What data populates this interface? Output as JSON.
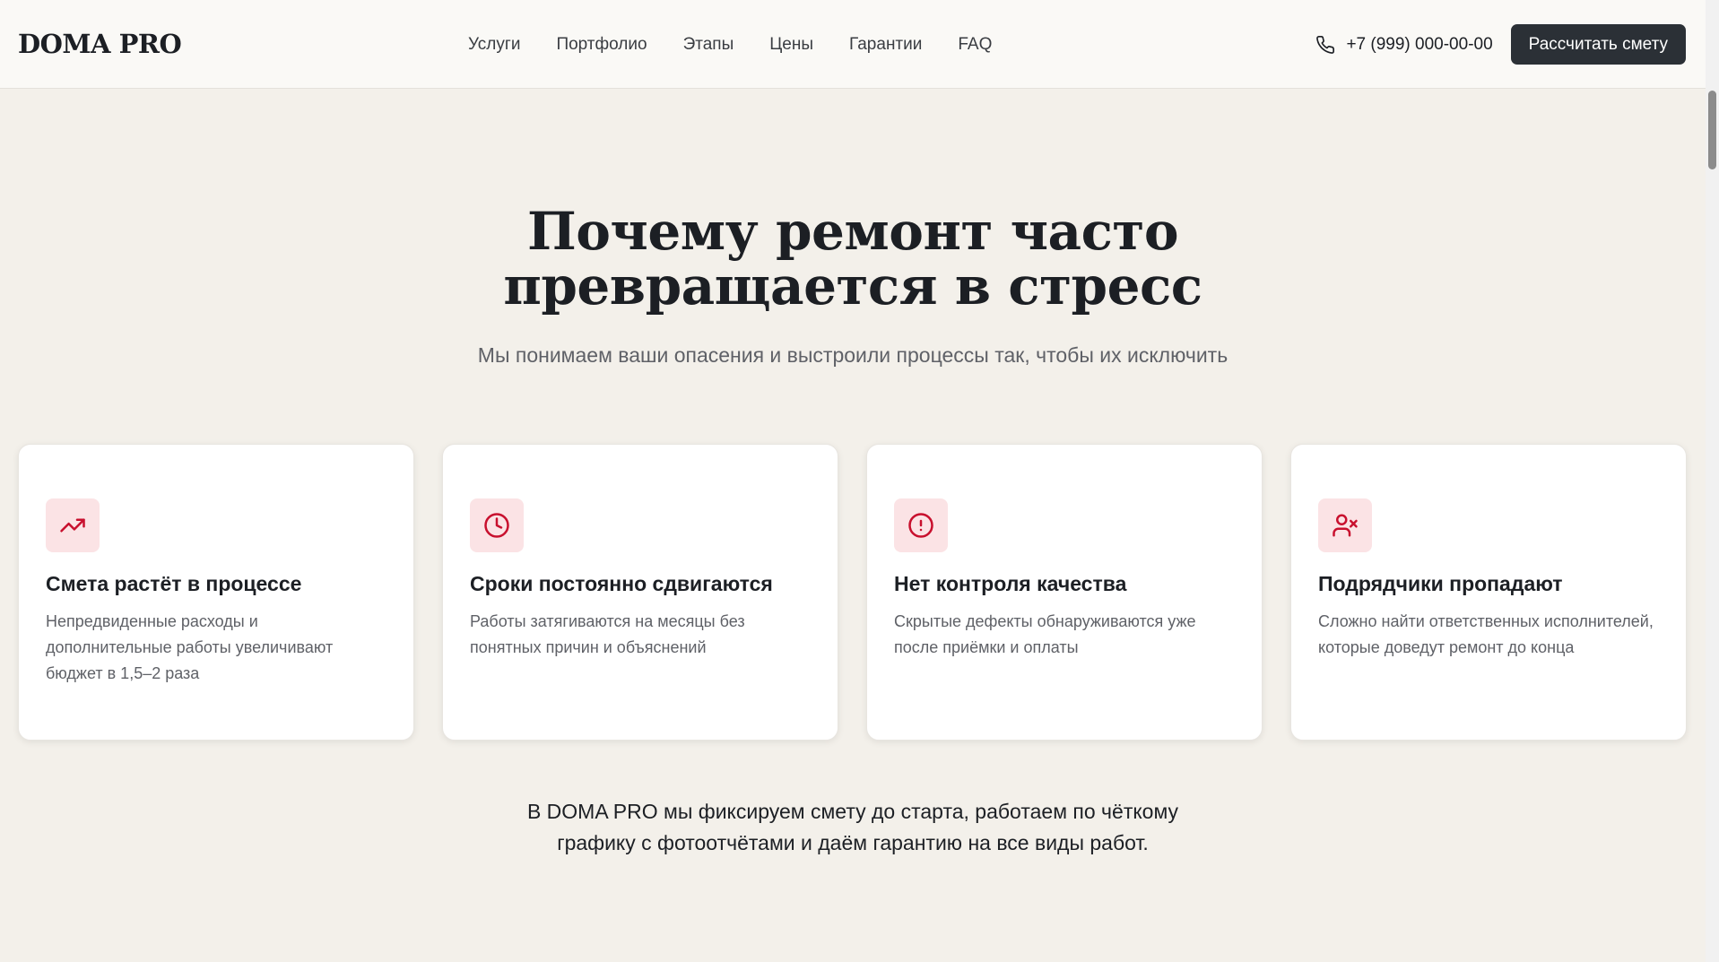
{
  "header": {
    "logo": "DOMA PRO",
    "nav": [
      "Услуги",
      "Портфолио",
      "Этапы",
      "Цены",
      "Гарантии",
      "FAQ"
    ],
    "phone": "+7 (999) 000-00-00",
    "cta_label": "Рассчитать смету"
  },
  "hero": {
    "title_line1": "Почему ремонт часто",
    "title_line2": "превращается в стресс",
    "subtitle": "Мы понимаем ваши опасения и выстроили процессы так, чтобы их исключить"
  },
  "cards": [
    {
      "icon": "trending-up-icon",
      "title": "Смета растёт в процессе",
      "text": "Непредвиденные расходы и дополнительные работы увеличивают бюджет в 1,5–2 раза"
    },
    {
      "icon": "clock-icon",
      "title": "Сроки постоянно сдвигаются",
      "text": "Работы затягиваются на месяцы без понятных причин и объяснений"
    },
    {
      "icon": "alert-circle-icon",
      "title": "Нет контроля качества",
      "text": "Скрытые дефекты обнаруживаются уже после приёмки и оплаты"
    },
    {
      "icon": "user-x-icon",
      "title": "Подрядчики пропадают",
      "text": "Сложно найти ответственных исполнителей, которые доведут ремонт до конца"
    }
  ],
  "footer": {
    "line1": "В DOMA PRO мы фиксируем смету до старта, работаем по чёткому",
    "line2": "графику с фотоотчётами и даём гарантию на все виды работ."
  },
  "colors": {
    "accent": "#c8102e",
    "icon_bg": "#fbe3e5",
    "button_bg": "#2b3036",
    "page_bg": "#f3f0ea"
  }
}
